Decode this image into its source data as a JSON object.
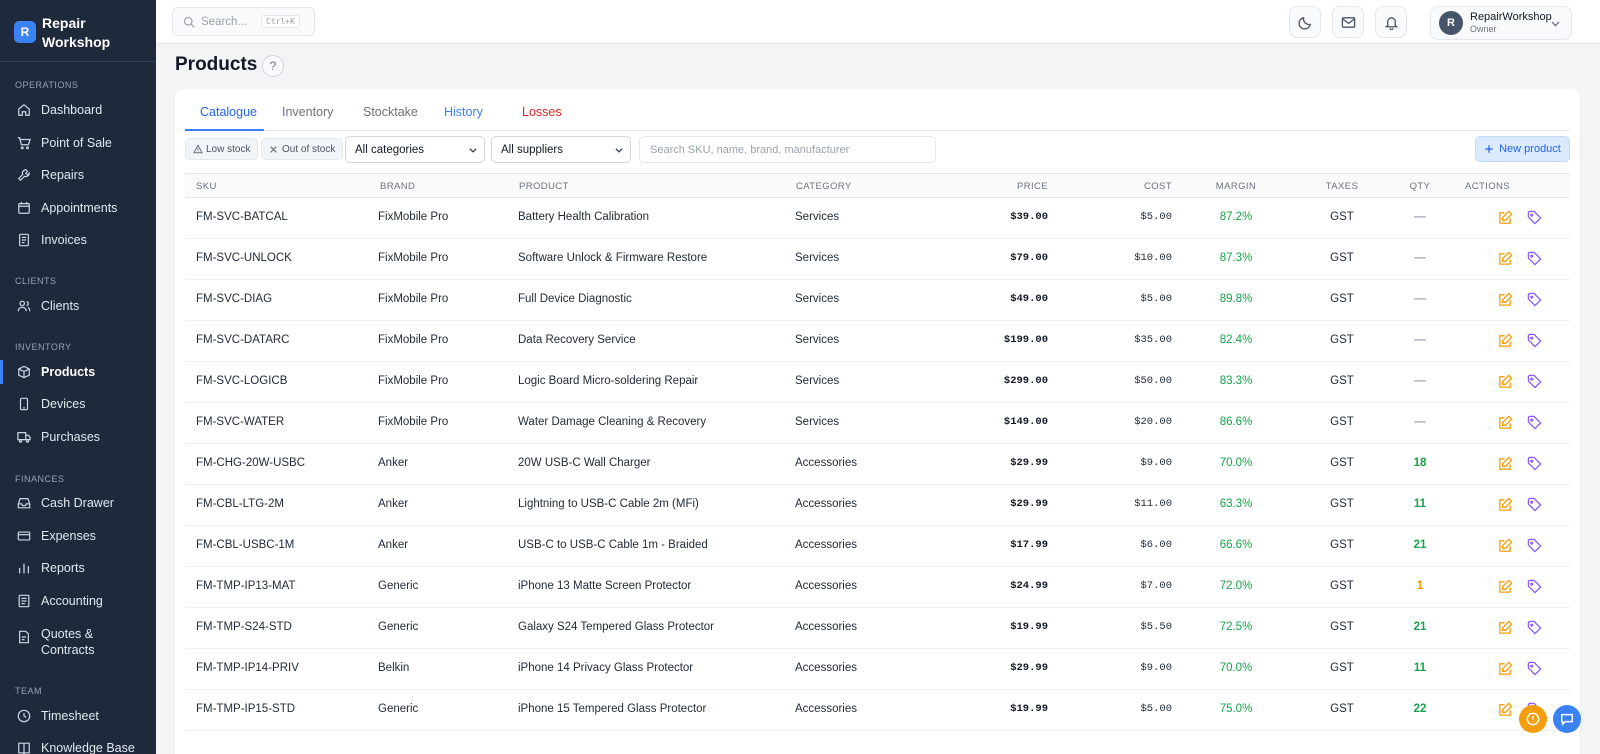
{
  "brand": {
    "logo": "R",
    "name": "Repair Workshop"
  },
  "sidebar": {
    "sections": [
      {
        "title": "OPERATIONS"
      },
      {
        "title": "CLIENTS"
      },
      {
        "title": "INVENTORY"
      },
      {
        "title": "FINANCES"
      },
      {
        "title": "TEAM"
      }
    ],
    "items": [
      {
        "label": "Dashboard",
        "icon": "home-icon"
      },
      {
        "label": "Point of Sale",
        "icon": "cart-icon"
      },
      {
        "label": "Repairs",
        "icon": "wrench-icon"
      },
      {
        "label": "Appointments",
        "icon": "calendar-icon"
      },
      {
        "label": "Invoices",
        "icon": "document-icon"
      },
      {
        "label": "Clients",
        "icon": "users-icon"
      },
      {
        "label": "Products",
        "icon": "box-icon",
        "active": true
      },
      {
        "label": "Devices",
        "icon": "phone-icon"
      },
      {
        "label": "Purchases",
        "icon": "truck-icon"
      },
      {
        "label": "Cash Drawer",
        "icon": "tray-icon"
      },
      {
        "label": "Expenses",
        "icon": "card-icon"
      },
      {
        "label": "Reports",
        "icon": "bar-chart-icon"
      },
      {
        "label": "Accounting",
        "icon": "ledger-icon"
      },
      {
        "label": "Quotes & Contracts",
        "icon": "contract-icon"
      },
      {
        "label": "Timesheet",
        "icon": "clock-icon"
      },
      {
        "label": "Knowledge Base",
        "icon": "book-icon"
      }
    ]
  },
  "topbar": {
    "search_placeholder": "Search...",
    "search_shortcut": "Ctrl+K",
    "user_initial": "R",
    "user_name": "RepairWorkshop",
    "user_role": "Owner"
  },
  "page": {
    "title": "Products",
    "help": "?"
  },
  "tabs": [
    {
      "label": "Catalogue",
      "active": true,
      "color": "#2563eb"
    },
    {
      "label": "Inventory",
      "color": "#6b7280"
    },
    {
      "label": "Stocktake",
      "color": "#6b7280"
    },
    {
      "label": "History",
      "color": "#3b82f6"
    },
    {
      "label": "Losses",
      "color": "#dc2626"
    }
  ],
  "filters": {
    "low_stock": "Low stock",
    "out_of_stock": "Out of stock",
    "category": "All categories",
    "supplier": "All suppliers",
    "search_placeholder": "Search SKU, name, brand, manufacturer",
    "new_product": "New product"
  },
  "table": {
    "headers": {
      "sku": "SKU",
      "brand": "BRAND",
      "product": "PRODUCT",
      "category": "CATEGORY",
      "price": "PRICE",
      "cost": "COST",
      "margin": "MARGIN",
      "taxes": "TAXES",
      "qty": "QTY",
      "actions": "ACTIONS"
    },
    "rows": [
      {
        "sku": "FM-SVC-BATCAL",
        "brand": "FixMobile Pro",
        "product": "Battery Health Calibration",
        "category": "Services",
        "price": "$39.00",
        "cost": "$5.00",
        "margin": "87.2%",
        "taxes": "GST",
        "qty": "—",
        "qty_color": "#9ca3af"
      },
      {
        "sku": "FM-SVC-UNLOCK",
        "brand": "FixMobile Pro",
        "product": "Software Unlock & Firmware Restore",
        "category": "Services",
        "price": "$79.00",
        "cost": "$10.00",
        "margin": "87.3%",
        "taxes": "GST",
        "qty": "—",
        "qty_color": "#9ca3af"
      },
      {
        "sku": "FM-SVC-DIAG",
        "brand": "FixMobile Pro",
        "product": "Full Device Diagnostic",
        "category": "Services",
        "price": "$49.00",
        "cost": "$5.00",
        "margin": "89.8%",
        "taxes": "GST",
        "qty": "—",
        "qty_color": "#9ca3af"
      },
      {
        "sku": "FM-SVC-DATARC",
        "brand": "FixMobile Pro",
        "product": "Data Recovery Service",
        "category": "Services",
        "price": "$199.00",
        "cost": "$35.00",
        "margin": "82.4%",
        "taxes": "GST",
        "qty": "—",
        "qty_color": "#9ca3af"
      },
      {
        "sku": "FM-SVC-LOGICB",
        "brand": "FixMobile Pro",
        "product": "Logic Board Micro-soldering Repair",
        "category": "Services",
        "price": "$299.00",
        "cost": "$50.00",
        "margin": "83.3%",
        "taxes": "GST",
        "qty": "—",
        "qty_color": "#9ca3af"
      },
      {
        "sku": "FM-SVC-WATER",
        "brand": "FixMobile Pro",
        "product": "Water Damage Cleaning & Recovery",
        "category": "Services",
        "price": "$149.00",
        "cost": "$20.00",
        "margin": "86.6%",
        "taxes": "GST",
        "qty": "—",
        "qty_color": "#9ca3af"
      },
      {
        "sku": "FM-CHG-20W-USBC",
        "brand": "Anker",
        "product": "20W USB-C Wall Charger",
        "category": "Accessories",
        "price": "$29.99",
        "cost": "$9.00",
        "margin": "70.0%",
        "taxes": "GST",
        "qty": "18",
        "qty_color": "#16a34a"
      },
      {
        "sku": "FM-CBL-LTG-2M",
        "brand": "Anker",
        "product": "Lightning to USB-C Cable 2m (MFi)",
        "category": "Accessories",
        "price": "$29.99",
        "cost": "$11.00",
        "margin": "63.3%",
        "taxes": "GST",
        "qty": "11",
        "qty_color": "#16a34a"
      },
      {
        "sku": "FM-CBL-USBC-1M",
        "brand": "Anker",
        "product": "USB-C to USB-C Cable 1m - Braided",
        "category": "Accessories",
        "price": "$17.99",
        "cost": "$6.00",
        "margin": "66.6%",
        "taxes": "GST",
        "qty": "21",
        "qty_color": "#16a34a"
      },
      {
        "sku": "FM-TMP-IP13-MAT",
        "brand": "Generic",
        "product": "iPhone 13 Matte Screen Protector",
        "category": "Accessories",
        "price": "$24.99",
        "cost": "$7.00",
        "margin": "72.0%",
        "taxes": "GST",
        "qty": "1",
        "qty_color": "#f59e0b"
      },
      {
        "sku": "FM-TMP-S24-STD",
        "brand": "Generic",
        "product": "Galaxy S24 Tempered Glass Protector",
        "category": "Accessories",
        "price": "$19.99",
        "cost": "$5.50",
        "margin": "72.5%",
        "taxes": "GST",
        "qty": "21",
        "qty_color": "#16a34a"
      },
      {
        "sku": "FM-TMP-IP14-PRIV",
        "brand": "Belkin",
        "product": "iPhone 14 Privacy Glass Protector",
        "category": "Accessories",
        "price": "$29.99",
        "cost": "$9.00",
        "margin": "70.0%",
        "taxes": "GST",
        "qty": "11",
        "qty_color": "#16a34a"
      },
      {
        "sku": "FM-TMP-IP15-STD",
        "brand": "Generic",
        "product": "iPhone 15 Tempered Glass Protector",
        "category": "Accessories",
        "price": "$19.99",
        "cost": "$5.00",
        "margin": "75.0%",
        "taxes": "GST",
        "qty": "22",
        "qty_color": "#16a34a"
      }
    ]
  },
  "colors": {
    "accent": "#3b82f6",
    "sidebar": "#1e293b",
    "edit": "#f59e0b",
    "tag": "#8b5cf6",
    "support": "#f59e0b",
    "chat": "#3b82f6"
  }
}
